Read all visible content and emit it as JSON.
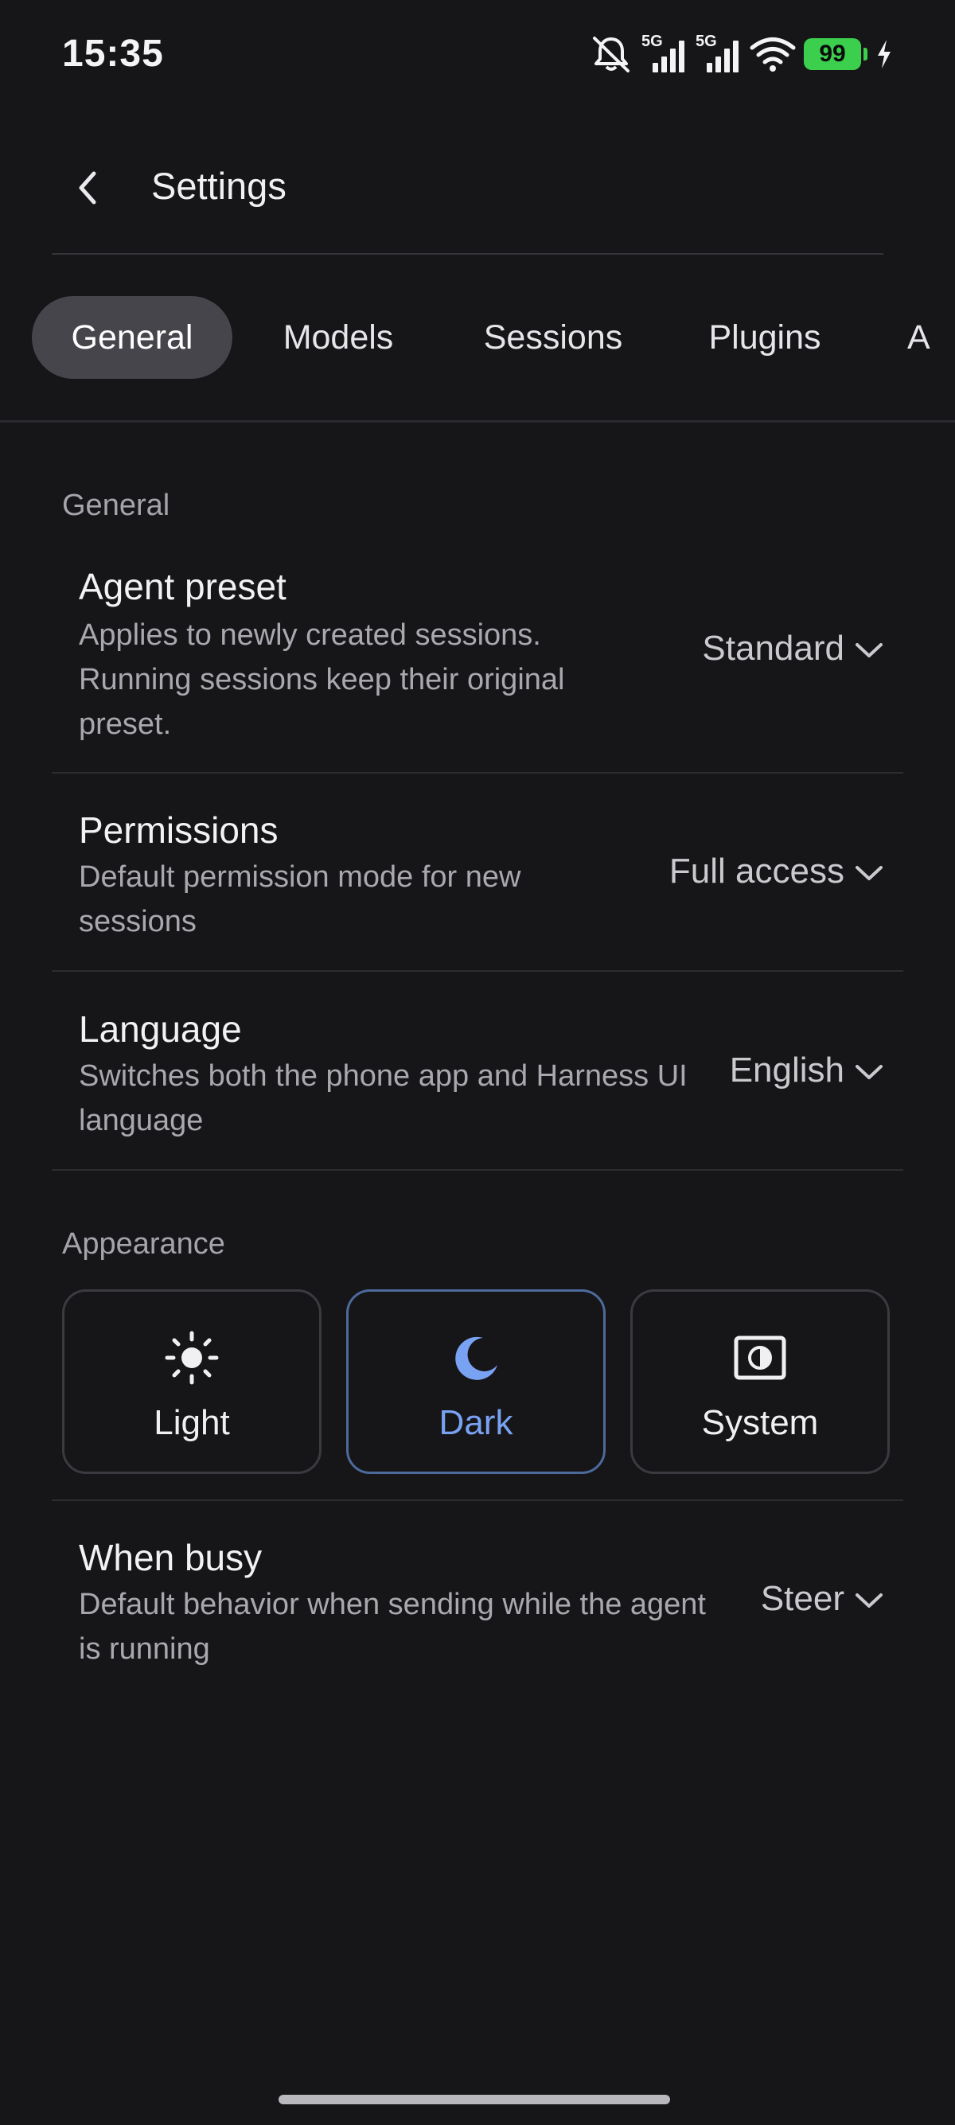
{
  "status_bar": {
    "time": "15:35",
    "network_1": "5G",
    "network_2": "5G",
    "battery": "99",
    "icons": [
      "bell-off-icon",
      "signal-icon",
      "signal-icon",
      "wifi-icon",
      "battery-icon",
      "charging-icon"
    ]
  },
  "header": {
    "title": "Settings"
  },
  "tabs": [
    {
      "label": "General",
      "active": true
    },
    {
      "label": "Models",
      "active": false
    },
    {
      "label": "Sessions",
      "active": false
    },
    {
      "label": "Plugins",
      "active": false
    },
    {
      "label": "A",
      "active": false
    }
  ],
  "general": {
    "section_label": "General",
    "agent_preset": {
      "title": "Agent preset",
      "description": "Applies to newly created sessions. Running sessions keep their original preset.",
      "value": "Standard"
    },
    "permissions": {
      "title": "Permissions",
      "description": "Default permission mode for new sessions",
      "value": "Full access"
    },
    "language": {
      "title": "Language",
      "description": "Switches both the phone app and Harness UI language",
      "value": "English"
    }
  },
  "appearance": {
    "section_label": "Appearance",
    "options": [
      {
        "label": "Light",
        "icon": "sun-icon",
        "selected": false
      },
      {
        "label": "Dark",
        "icon": "moon-icon",
        "selected": true
      },
      {
        "label": "System",
        "icon": "system-theme-icon",
        "selected": false
      }
    ]
  },
  "when_busy": {
    "title": "When busy",
    "description": "Default behavior when sending while the agent is running",
    "value": "Steer"
  },
  "colors": {
    "background": "#161619",
    "active_tab": "#45454b",
    "accent": "#7aa2f3",
    "battery": "#3ccf4e"
  }
}
